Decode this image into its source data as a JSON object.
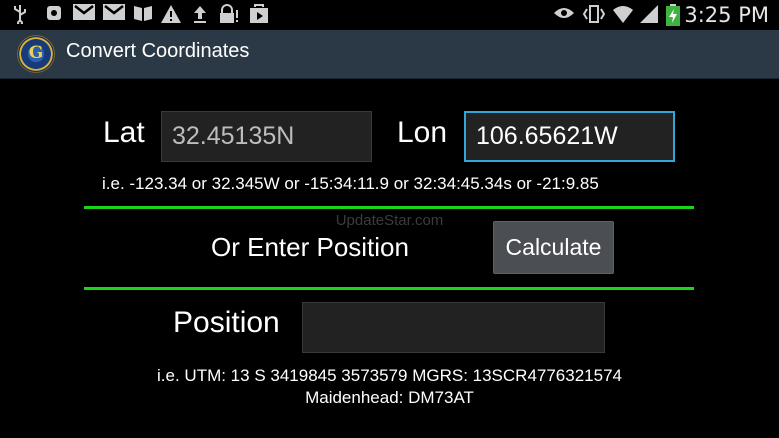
{
  "status_bar": {
    "icons": [
      "usb-icon",
      "record-icon",
      "gmail-icon",
      "gmail-icon",
      "book-icon",
      "warning-icon",
      "upload-icon",
      "lock-warning-icon",
      "play-store-icon"
    ],
    "right_icons": [
      "eye-icon",
      "vibrate-icon",
      "wifi-icon",
      "signal-icon",
      "battery-charging-icon"
    ],
    "time": "3:25 PM"
  },
  "action_bar": {
    "title": "Convert Coordinates",
    "background": "#2b3947"
  },
  "form": {
    "lat_label": "Lat",
    "lat_value": "32.45135N",
    "lon_label": "Lon",
    "lon_value": "106.65621W",
    "coord_hint": "i.e. -123.34 or 32.345W or -15:34:11.9 or 32:34:45.34s or -21:9.85",
    "or_enter_label": "Or Enter Position",
    "calculate_label": "Calculate",
    "position_label": "Position",
    "position_value": "",
    "position_hint_line1": "i.e. UTM: 13 S 3419845 3573579  MGRS: 13SCR4776321574",
    "position_hint_line2": "Maidenhead: DM73AT"
  },
  "watermark": "UpdateStar.com",
  "colors": {
    "divider": "#1bd51b",
    "focus_border": "#33a6d6"
  }
}
